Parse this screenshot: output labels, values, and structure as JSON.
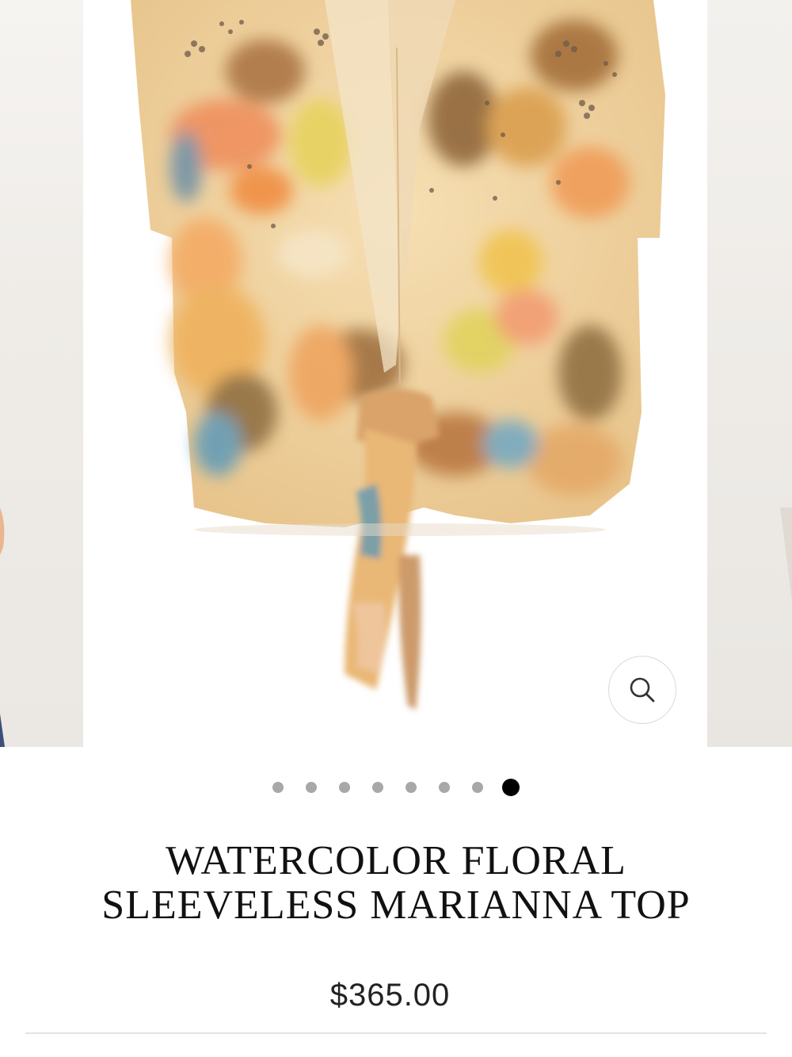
{
  "product": {
    "title_line1": "WATERCOLOR FLORAL",
    "title_line2": "SLEEVELESS MARIANNA TOP",
    "price": "$365.00"
  },
  "carousel": {
    "slide_count": 8,
    "active_index": 8
  },
  "icons": {
    "zoom": "magnifier-icon"
  },
  "colors": {
    "active_dot": "#000000",
    "inactive_dot": "#a8a8a8",
    "title_text": "#111111",
    "divider": "#e3e3e3"
  }
}
